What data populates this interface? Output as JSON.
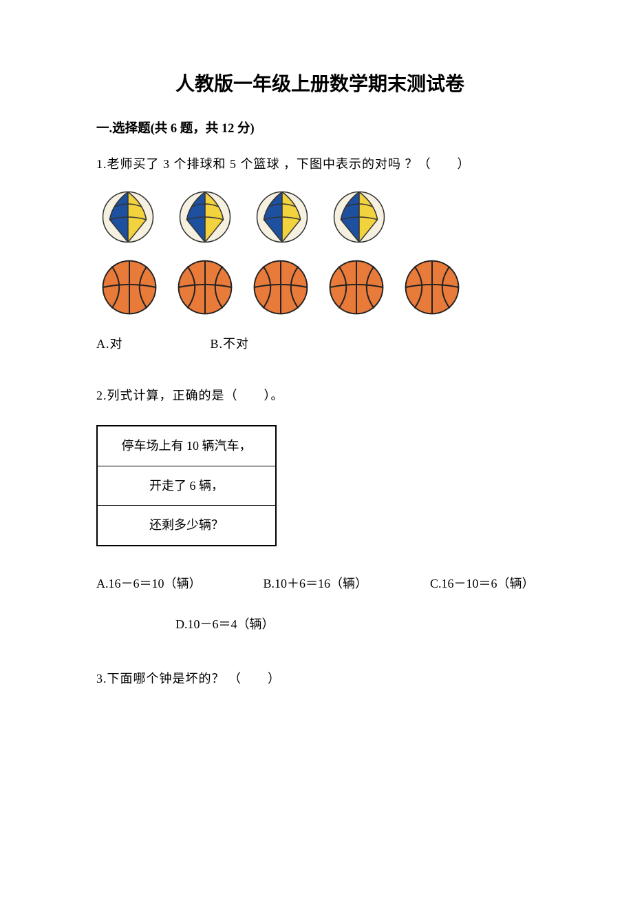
{
  "title": "人教版一年级上册数学期末测试卷",
  "section1": {
    "heading": "一.选择题(共 6 题，共 12 分)"
  },
  "q1": {
    "text": "1.老师买了 3 个排球和 5 个篮球 ，下图中表示的对吗 ？（　　）",
    "optA": "A.对",
    "optB": "B.不对"
  },
  "q2": {
    "text": "2.列式计算，正确的是（　　）。",
    "box": {
      "r1": "停车场上有 10 辆汽车，",
      "r2": "开走了 6 辆，",
      "r3": "还剩多少辆？"
    },
    "optA": "A.16－6＝10（辆）",
    "optB": "B.10＋6＝16（辆）",
    "optC": "C.16－10＝6（辆）",
    "optD": "D.10－6＝4（辆）"
  },
  "q3": {
    "text": "3.下面哪个钟是坏的？ （　　）"
  }
}
